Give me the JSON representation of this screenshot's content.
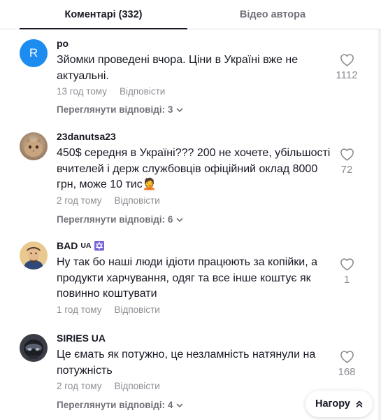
{
  "tabs": {
    "comments": "Коментарі (332)",
    "author_videos": "Відео автора"
  },
  "comments": [
    {
      "avatar_letter": "R",
      "username": "po",
      "text": "Зйомки проведені вчора. Ціни в Україні вже не актуальні.",
      "time": "13 год тому",
      "reply": "Відповісти",
      "view_replies": "Переглянути відповіді: 3",
      "likes": "1112"
    },
    {
      "username": "23danutsa23",
      "text": "450$ середня в Україні??? 200 не хочете, убільшості вчителей і держ службовців офіційний оклад 8000 грн, може 10 тис🤦",
      "time": "2 год тому",
      "reply": "Відповісти",
      "view_replies": "Переглянути відповіді: 6",
      "likes": "72"
    },
    {
      "username": "BAD",
      "badge": "UA",
      "text": "Ну так бо наші люди ідіоти працюють за копійки, а продукти харчування, одяг та все інше коштує як повинно коштувати",
      "time": "1 год тому",
      "reply": "Відповісти",
      "likes": "1"
    },
    {
      "username": "SIRIES UA",
      "text": "Це ємать як потужно, це незламність натянули на потужність",
      "time": "2 год тому",
      "reply": "Відповісти",
      "view_replies": "Переглянути відповіді: 4",
      "likes": "168"
    }
  ],
  "back_to_top": "Нагору",
  "icons": {
    "like": "heart-outline-icon",
    "expand": "chevron-down-icon",
    "back_to_top": "double-chevron-up-icon",
    "badge": "star-of-david-icon"
  },
  "colors": {
    "avatar_letter_bg": "#1d8cf0",
    "text_primary": "#161823",
    "text_secondary": "#8a8b91",
    "badge_bg": "#7b63d8"
  }
}
